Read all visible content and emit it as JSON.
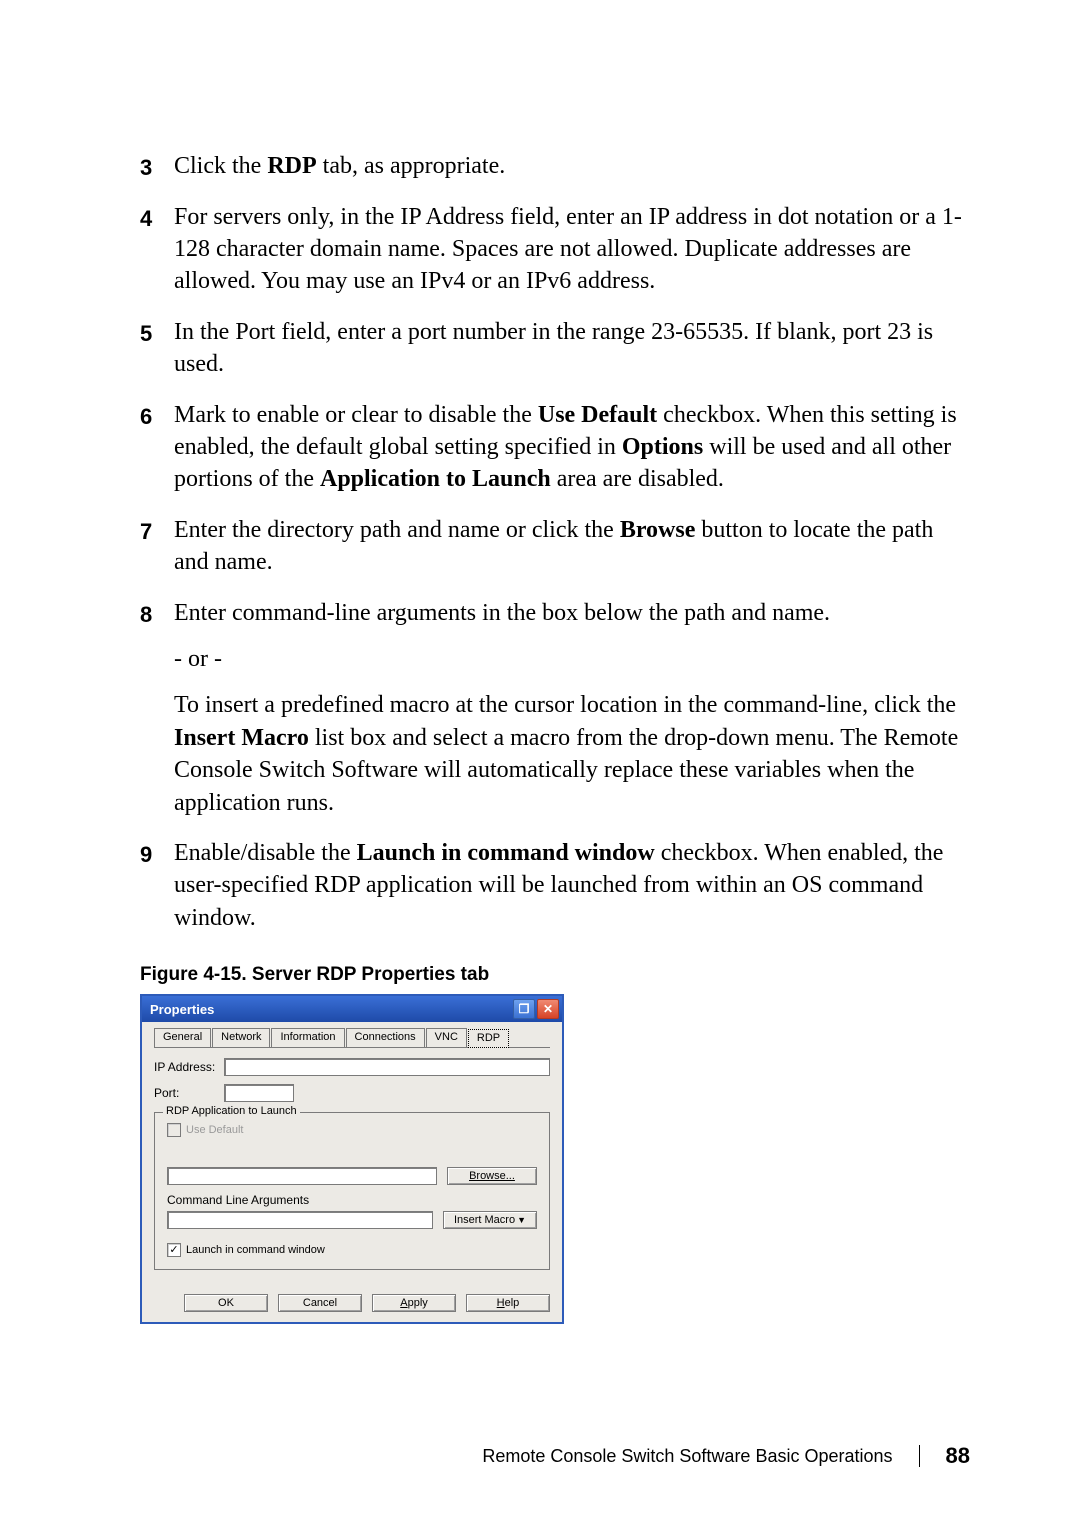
{
  "steps": [
    {
      "n": "3",
      "paras": [
        {
          "parts": [
            {
              "t": "Click the "
            },
            {
              "t": "RDP",
              "b": true
            },
            {
              "t": " tab, as appropriate."
            }
          ]
        }
      ]
    },
    {
      "n": "4",
      "paras": [
        {
          "parts": [
            {
              "t": "For servers only, in the IP Address field, enter an IP address in dot notation or a 1-128 character domain name. Spaces are not allowed. Duplicate addresses are allowed. You may use an IPv4 or an IPv6 address."
            }
          ]
        }
      ]
    },
    {
      "n": "5",
      "paras": [
        {
          "parts": [
            {
              "t": "In the Port field, enter a port number in the range 23-65535. If blank, port 23 is used."
            }
          ]
        }
      ]
    },
    {
      "n": "6",
      "paras": [
        {
          "parts": [
            {
              "t": "Mark to enable or clear to disable the "
            },
            {
              "t": "Use Default",
              "b": true
            },
            {
              "t": " checkbox. When this setting is enabled, the default global setting specified in "
            },
            {
              "t": "Options",
              "b": true
            },
            {
              "t": " will be used and all other portions of the "
            },
            {
              "t": "Application to Launch",
              "b": true
            },
            {
              "t": " area are disabled."
            }
          ]
        }
      ]
    },
    {
      "n": "7",
      "paras": [
        {
          "parts": [
            {
              "t": "Enter the directory path and name or click the "
            },
            {
              "t": "Browse",
              "b": true
            },
            {
              "t": " button to locate the path and name."
            }
          ]
        }
      ]
    },
    {
      "n": "8",
      "paras": [
        {
          "parts": [
            {
              "t": "Enter command-line arguments in the box below the path and name."
            }
          ]
        },
        {
          "parts": [
            {
              "t": "- or -"
            }
          ]
        },
        {
          "parts": [
            {
              "t": "To insert a predefined macro at the cursor location in the command-line, click the "
            },
            {
              "t": "Insert Macro",
              "b": true
            },
            {
              "t": " list box and select a macro from the drop-down menu. The Remote Console Switch Software will automatically replace these variables when the application runs."
            }
          ]
        }
      ]
    },
    {
      "n": "9",
      "paras": [
        {
          "parts": [
            {
              "t": "Enable/disable the "
            },
            {
              "t": "Launch in command window",
              "b": true
            },
            {
              "t": " checkbox. When enabled, the user-specified RDP application will be launched from within an OS command window."
            }
          ]
        }
      ]
    }
  ],
  "figure_caption": "Figure 4-15.    Server RDP Properties tab",
  "dialog": {
    "title": "Properties",
    "tabs": [
      "General",
      "Network",
      "Information",
      "Connections",
      "VNC",
      "RDP"
    ],
    "active_tab_index": 5,
    "fields": {
      "ip_label": "IP Address:",
      "port_label": "Port:",
      "group_legend": "RDP Application to Launch",
      "use_default_label": "Use Default",
      "cmd_args_label": "Command Line Arguments",
      "browse_label": "Browse...",
      "insert_macro_label": "Insert Macro",
      "launch_label": "Launch in command window",
      "launch_checked": true
    },
    "buttons": {
      "ok": "OK",
      "cancel": "Cancel",
      "apply": "Apply",
      "help": "Help"
    }
  },
  "footer": {
    "section": "Remote Console Switch Software Basic Operations",
    "page": "88"
  }
}
